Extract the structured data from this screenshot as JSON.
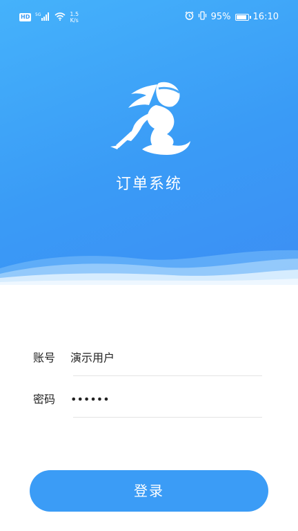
{
  "status_bar": {
    "hd": "HD",
    "signal_label": "5G",
    "speed_value": "1.5",
    "speed_unit": "K/s",
    "battery": "95%",
    "battery_level": 0.95,
    "time": "16:10",
    "icons": [
      "hd-icon",
      "signal-icon",
      "wifi-icon",
      "alarm-icon",
      "vibrate-icon",
      "battery-icon"
    ]
  },
  "app": {
    "title": "订单系统",
    "logo": "runner-logo"
  },
  "form": {
    "account_label": "账号",
    "account_value": "演示用户",
    "password_label": "密码",
    "password_value": "••••••"
  },
  "login_button": "登录",
  "colors": {
    "primary": "#3b9cf6",
    "hero_top": "#45b2fb",
    "divider": "#e3e3e3"
  }
}
